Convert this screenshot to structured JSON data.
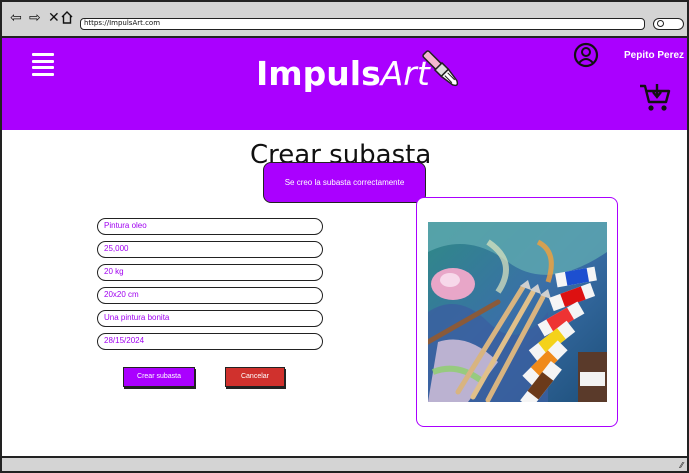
{
  "browser": {
    "url": "https://ImpulsArt.com",
    "icons": [
      "back-arrow-icon",
      "forward-arrow-icon",
      "close-icon",
      "home-icon",
      "search-icon"
    ]
  },
  "header": {
    "logo_bold": "Impuls",
    "logo_italic": "Art",
    "user_name": "Pepito Perez",
    "brand_color": "#aa00ff"
  },
  "page": {
    "title": "Crear subasta",
    "toast": "Se creo la subasta correctamente"
  },
  "form": {
    "fields": [
      {
        "value": "Pintura oleo"
      },
      {
        "value": "25,000"
      },
      {
        "value": "20 kg"
      },
      {
        "value": "20x20 cm"
      },
      {
        "value": "Una pintura bonita"
      },
      {
        "value": "28/15/2024"
      }
    ],
    "create_label": "Crear subasta",
    "cancel_label": "Cancelar",
    "create_color": "#aa00ff",
    "cancel_color": "#d0312d"
  }
}
